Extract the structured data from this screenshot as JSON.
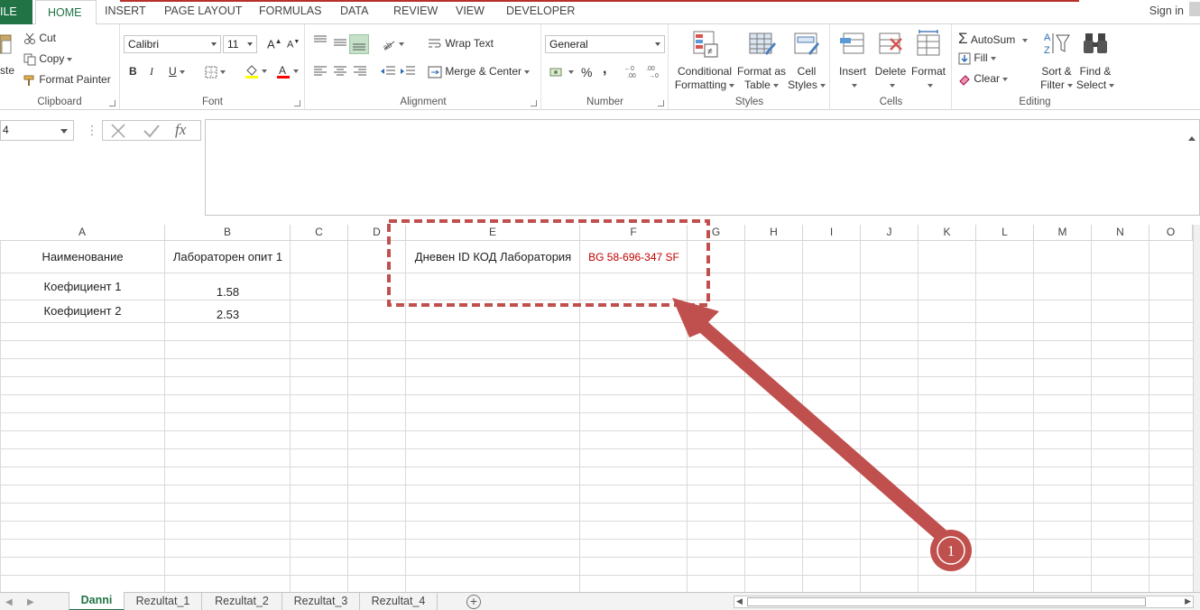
{
  "ribbon_tabs": {
    "file": "ILE",
    "home": "HOME",
    "insert": "INSERT",
    "page_layout": "PAGE LAYOUT",
    "formulas": "FORMULAS",
    "data": "DATA",
    "review": "REVIEW",
    "view": "VIEW",
    "developer": "DEVELOPER",
    "sign_in": "Sign in"
  },
  "clipboard": {
    "paste": "ste",
    "cut": "Cut",
    "copy": "Copy",
    "format_painter": "Format Painter",
    "label": "Clipboard"
  },
  "font": {
    "name": "Calibri",
    "size": "11",
    "bold": "B",
    "italic": "I",
    "underline": "U",
    "label": "Font",
    "grow": "A",
    "shrink": "A"
  },
  "alignment": {
    "wrap_text": "Wrap Text",
    "merge_center": "Merge & Center",
    "label": "Alignment"
  },
  "number": {
    "format": "General",
    "percent": "%",
    "comma": ",",
    "label": "Number"
  },
  "styles": {
    "conditional_1": "Conditional",
    "conditional_2": "Formatting",
    "format_table_1": "Format as",
    "format_table_2": "Table",
    "cell_styles_1": "Cell",
    "cell_styles_2": "Styles",
    "label": "Styles"
  },
  "cells": {
    "insert": "Insert",
    "delete": "Delete",
    "format": "Format",
    "label": "Cells"
  },
  "editing": {
    "autosum": "AutoSum",
    "fill": "Fill",
    "clear": "Clear",
    "sort_1": "Sort &",
    "sort_2": "Filter",
    "find_1": "Find &",
    "find_2": "Select",
    "label": "Editing"
  },
  "formula_bar": {
    "name_box": "4",
    "fx": "fx",
    "content": ""
  },
  "columns": [
    "A",
    "B",
    "C",
    "D",
    "E",
    "F",
    "G",
    "H",
    "I",
    "J",
    "K",
    "L",
    "M",
    "N",
    "O"
  ],
  "cells_data": {
    "a1": "Наименование",
    "b1": "Лабораторен опит 1",
    "e1": "Дневен ID КОД Лаборатория",
    "f1": "BG 58-696-347 SF",
    "a2": "Коефициент 1",
    "b2": "1.58",
    "a3": "Коефициент 2",
    "b3": "2.53"
  },
  "sheets": [
    "Danni",
    "Rezultat_1",
    "Rezultat_2",
    "Rezultat_3",
    "Rezultat_4"
  ],
  "annotation": {
    "number": "1",
    "color": "#c0504d"
  },
  "colors": {
    "excel_green": "#217346",
    "highlight_red": "#c00000",
    "annotation_red": "#c0504d"
  }
}
